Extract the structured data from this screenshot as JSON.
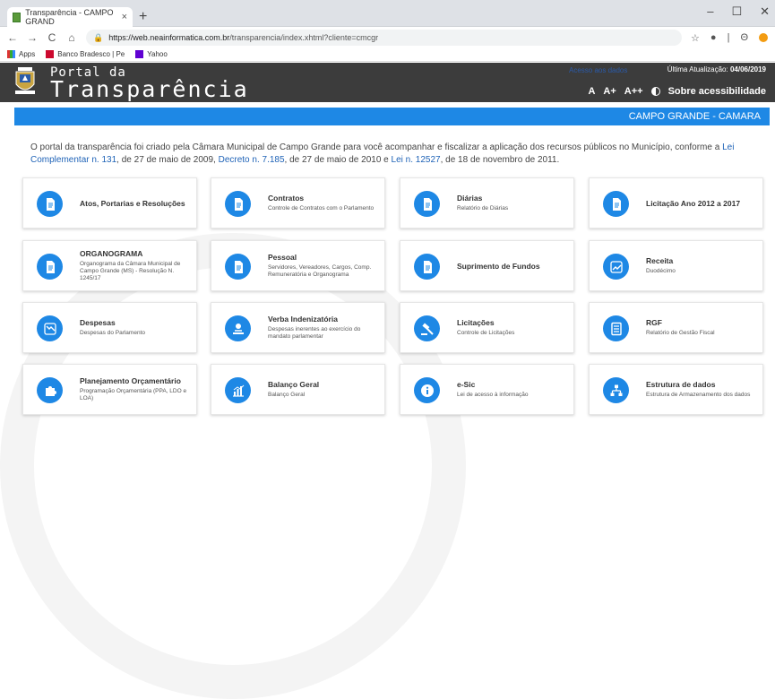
{
  "slide": {
    "title_fragment": "Portal da Transparência"
  },
  "browser": {
    "tab_title": "Transparência - CAMPO GRAND",
    "tab_close": "×",
    "new_tab": "+",
    "url_host": "https://web.neainformatica.com.br",
    "url_path": "/transparencia/index.xhtml?cliente=cmcgr",
    "bookmarks": [
      {
        "label": "Apps",
        "icon": "apps-grid-icon"
      },
      {
        "label": "Banco Bradesco | Pe",
        "icon": "bradesco-icon"
      },
      {
        "label": "Yahoo",
        "icon": "yahoo-icon"
      }
    ]
  },
  "header": {
    "portal_small": "Portal da",
    "portal_big": "Transparência",
    "update_link": "Acesso aos dados",
    "update_label": "Última Atualização:",
    "update_date": "04/06/2019",
    "font_a": "A",
    "font_a_plus": "A+",
    "font_a_plus_plus": "A++",
    "accessibility": "Sobre acessibilidade"
  },
  "bluebar": {
    "label": "CAMPO GRANDE - CAMARA"
  },
  "intro": {
    "text_1": "O portal da transparência foi criado pela  Câmara Municipal de Campo Grande para você acompanhar e fiscalizar a aplicação dos recursos públicos no Município, conforme a ",
    "link_1": "Lei Complementar n. 131",
    "text_2": ", de 27 de maio de 2009, ",
    "link_2": "Decreto n. 7.185",
    "text_3": ", de 27 de maio de 2010 e  ",
    "link_3": "Lei n. 12527",
    "text_4": ", de 18 de novembro de 2011."
  },
  "cards": [
    {
      "title": "Atos, Portarias e Resoluções",
      "subtitle": "",
      "icon": "document-icon"
    },
    {
      "title": "Contratos",
      "subtitle": "Controle de Contratos com o Parlamento",
      "icon": "document-icon"
    },
    {
      "title": "Diárias",
      "subtitle": "Relatório de Diárias",
      "icon": "document-icon"
    },
    {
      "title": "Licitação Ano 2012 a 2017",
      "subtitle": "",
      "icon": "document-icon"
    },
    {
      "title": "ORGANOGRAMA",
      "subtitle": "Organograma da Câmara Municipal de Campo Grande (MS) - Resolução N. 1245/17",
      "icon": "document-icon"
    },
    {
      "title": "Pessoal",
      "subtitle": "Servidores, Vereadores, Cargos, Comp. Remuneratória e Organograma",
      "icon": "document-icon"
    },
    {
      "title": "Suprimento de Fundos",
      "subtitle": "",
      "icon": "document-icon"
    },
    {
      "title": "Receita",
      "subtitle": "Duodécimo",
      "icon": "trending-up-icon"
    },
    {
      "title": "Despesas",
      "subtitle": "Despesas do Parlamento",
      "icon": "trending-down-icon"
    },
    {
      "title": "Verba Indenizatória",
      "subtitle": "Despesas inerentes ao exercício do mandato parlamentar",
      "icon": "money-hand-icon"
    },
    {
      "title": "Licitações",
      "subtitle": "Controle de Licitações",
      "icon": "gavel-icon"
    },
    {
      "title": "RGF",
      "subtitle": "Relatório de Gestão Fiscal",
      "icon": "report-icon"
    },
    {
      "title": "Planejamento Orçamentário",
      "subtitle": "Programação Orçamentária (PPA, LDO e LOA)",
      "icon": "puzzle-icon"
    },
    {
      "title": "Balanço Geral",
      "subtitle": "Balanço Geral",
      "icon": "bar-chart-icon"
    },
    {
      "title": "e-Sic",
      "subtitle": "Lei de acesso à informação",
      "icon": "info-icon"
    },
    {
      "title": "Estrutura de dados",
      "subtitle": "Estrutura de Armazenamento dos dados",
      "icon": "sitemap-icon"
    }
  ],
  "colors": {
    "accent": "#1e88e5",
    "header_bg": "#3c3c3c"
  }
}
